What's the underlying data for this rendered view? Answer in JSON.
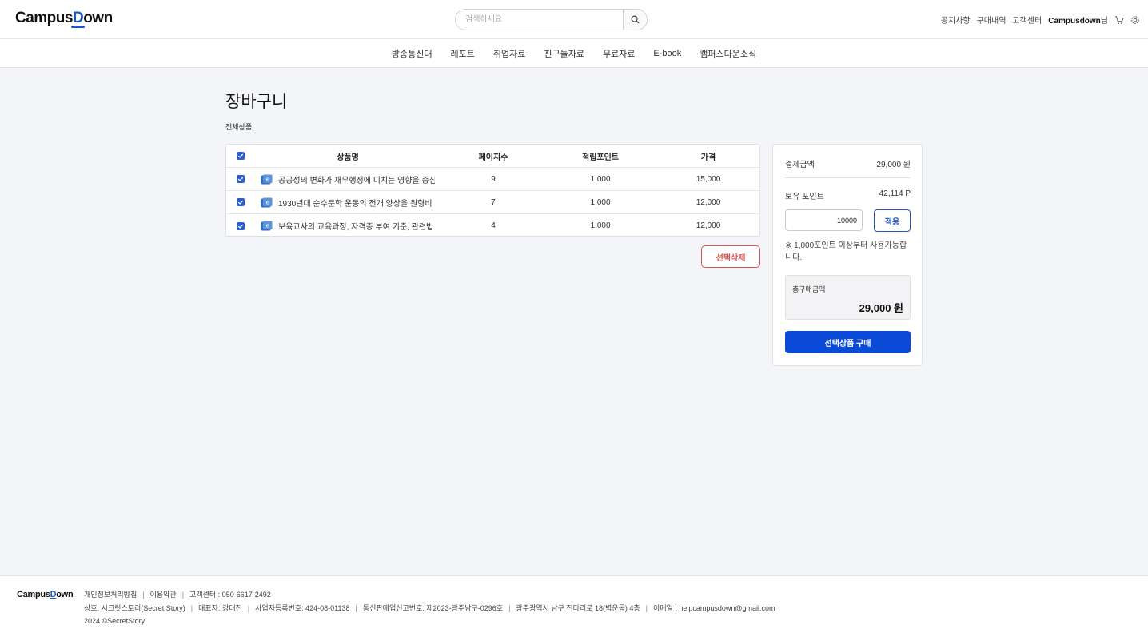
{
  "header": {
    "logo_prefix": "Campus",
    "logo_d": "D",
    "logo_suffix": "own",
    "search_placeholder": "검색하세요",
    "links": [
      "공지사항",
      "구매내역",
      "고객센터"
    ],
    "user_name": "Campusdown",
    "user_suffix": "님"
  },
  "nav": [
    "방송통신대",
    "레포트",
    "취업자료",
    "친구들자료",
    "무료자료",
    "E-book",
    "캠퍼스다운소식"
  ],
  "main": {
    "title": "장바구니",
    "subtitle": "전체상품",
    "table": {
      "headers": {
        "name": "상품명",
        "pages": "페이지수",
        "points": "적립포인트",
        "price": "가격"
      },
      "rows": [
        {
          "name": "공공성의 변화가 재무행정에 미치는 영향을 중심",
          "pages": "9",
          "points": "1,000",
          "price": "15,000",
          "checked": true
        },
        {
          "name": "1930년대 순수문학 운동의 전개 양상을 원형비",
          "pages": "7",
          "points": "1,000",
          "price": "12,000",
          "checked": true
        },
        {
          "name": "보육교사의 교육과정, 자격증 부여 기준, 관련법",
          "pages": "4",
          "points": "1,000",
          "price": "12,000",
          "checked": true
        }
      ]
    },
    "delete_label": "선택삭제"
  },
  "summary": {
    "pay_label": "결제금액",
    "pay_value": "29,000 원",
    "points_label": "보유 포인트",
    "points_value": "42,114 P",
    "points_input": "10000",
    "apply_label": "적용",
    "notice": "※ 1,000포인트 이상부터 사용가능합니다.",
    "total_label": "총구매금액",
    "total_value": "29,000 원",
    "buy_label": "선택상품 구매"
  },
  "footer": {
    "logo_prefix": "Campus",
    "logo_d": "D",
    "logo_suffix": "own",
    "line1": [
      "개인정보처리방침",
      "이용약관",
      "고객센터 : 050-6617-2492"
    ],
    "line2": [
      "상호: 시크릿스토리(Secret Story)",
      "대표자: 강대진",
      "사업자등록번호: 424-08-01138",
      "통신판매업신고번호: 제2023-광주남구-0296호",
      "광주광역시 남구 진다리로 18(벽운동) 4층",
      "이메일 : helpcampusdown@gmail.com"
    ],
    "copyright": "2024 ©SecretStory"
  },
  "colors": {
    "accent": "#0b4ad8",
    "delete": "#d9534f",
    "checkbox": "#2b5fcf"
  }
}
